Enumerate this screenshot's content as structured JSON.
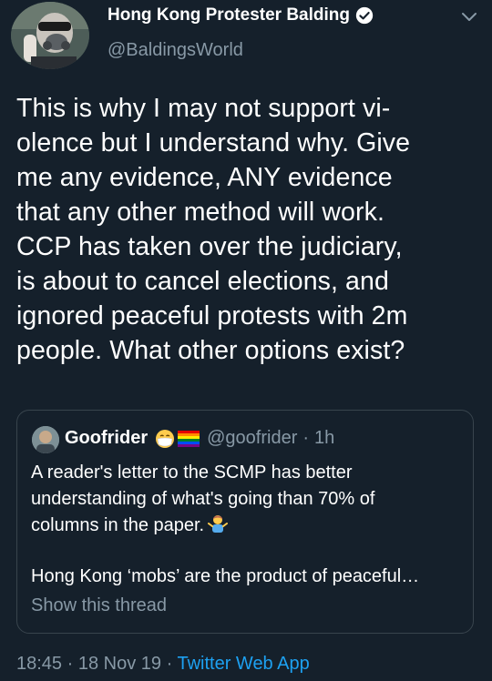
{
  "header": {
    "display_name": "Hong Kong Protester Balding",
    "handle": "@BaldingsWorld"
  },
  "tweet": {
    "lines": [
      "This is why I may not support vi-",
      "olence but I understand why. Give",
      "me any evidence, ANY evidence",
      "that any other method will work.",
      "CCP has taken over the judiciary,",
      "is about to cancel elections, and",
      "ignored peaceful protests with 2m",
      "people. What other options exist?"
    ]
  },
  "quote": {
    "name": "Goofrider",
    "handle": "@goofrider",
    "separator": "·",
    "time": "1h",
    "lines": [
      "A reader's letter to the SCMP has better",
      "understanding of what's going than 70% of",
      "columns in the paper."
    ],
    "paragraph2": "Hong Kong ‘mobs’ are the product of peaceful…",
    "show_thread": "Show this thread"
  },
  "footer": {
    "time": "18:45",
    "sep1": "·",
    "date": "18 Nov 19",
    "sep2": "·",
    "source": "Twitter Web App"
  },
  "colors": {
    "background": "#15202b",
    "text": "#ffffff",
    "secondary": "#8899a6",
    "link": "#1da1f2",
    "border": "#38444d"
  },
  "icons": {
    "verified": "verified-badge-icon",
    "more": "chevron-down-icon",
    "emoji_mask": "face-with-medical-mask-icon",
    "emoji_flag": "rainbow-flag-icon",
    "emoji_person": "person-gesturing-icon"
  }
}
